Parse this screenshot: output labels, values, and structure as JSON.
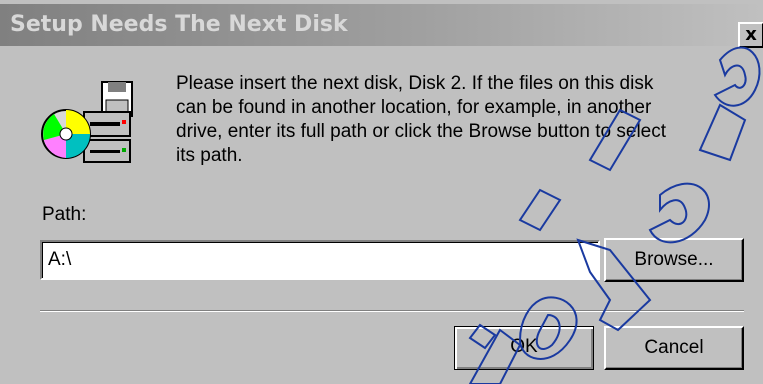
{
  "dialog": {
    "title": "Setup Needs The Next Disk",
    "close_label": "x",
    "message": "Please insert the next disk, Disk 2. If the files on this disk\ncan be found in another location, for example, in another\ndrive, enter its full path or click the Browse button to select\nits path.",
    "path_label": "Path:",
    "path_value": "A:\\",
    "browse_label": "Browse...",
    "ok_label": "OK",
    "cancel_label": "Cancel"
  },
  "icons": {
    "setup": "setup-disk-icon",
    "close": "close-icon"
  },
  "colors": {
    "face": "#c0c0c0",
    "title_start": "#808080",
    "title_end": "#c0c0c0",
    "watermark": "#1a3aa0"
  }
}
